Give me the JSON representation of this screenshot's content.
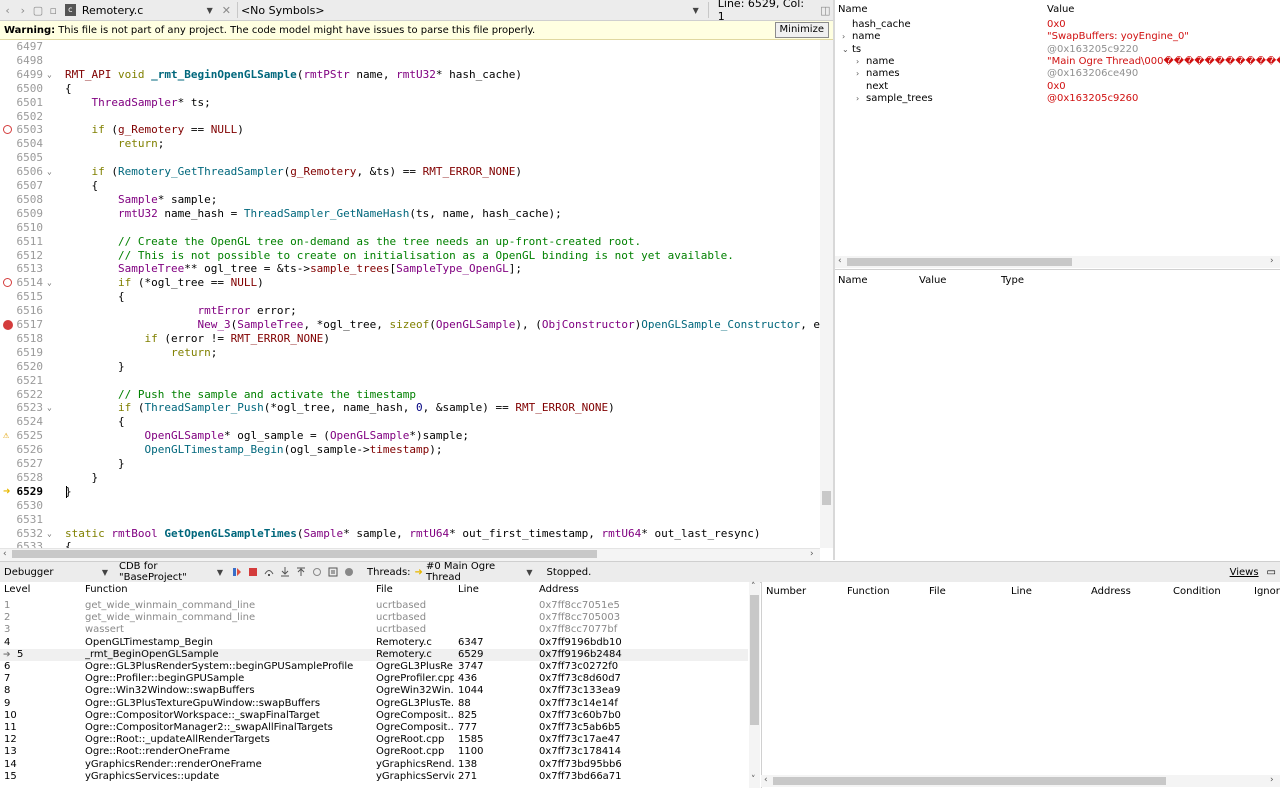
{
  "editor_toolbar": {
    "file_name": "Remotery.c",
    "file_icon": "c-file-icon",
    "symbols": "<No Symbols>",
    "line_col": "Line: 6529, Col: 1"
  },
  "warning": {
    "label": "Warning:",
    "message": "This file is not part of any project. The code model might have issues to parse this file properly.",
    "button": "Minimize"
  },
  "code_lines": [
    {
      "ln": "6497",
      "html": ""
    },
    {
      "ln": "6498",
      "html": ""
    },
    {
      "ln": "6499",
      "fold": true,
      "html": "<span class='mac'>RMT_API</span> <span class='kw'>void</span> <span class='bold-fn'>_rmt_BeginOpenGLSample</span>(<span class='tp'>rmtPStr</span> name, <span class='tp'>rmtU32</span>* hash_cache)"
    },
    {
      "ln": "6500",
      "html": "{"
    },
    {
      "ln": "6501",
      "html": "    <span class='tp'>ThreadSampler</span>* ts;"
    },
    {
      "ln": "6502",
      "html": ""
    },
    {
      "ln": "6503",
      "marker": "bp",
      "html": "    <span class='kw'>if</span> (<span class='mac'>g_Remotery</span> == <span class='mac'>NULL</span>)"
    },
    {
      "ln": "6504",
      "html": "        <span class='kw'>return</span>;"
    },
    {
      "ln": "6505",
      "html": ""
    },
    {
      "ln": "6506",
      "fold": true,
      "html": "    <span class='kw'>if</span> (<span class='fn'>Remotery_GetThreadSampler</span>(<span class='mac'>g_Remotery</span>, &amp;ts) == <span class='mac'>RMT_ERROR_NONE</span>)"
    },
    {
      "ln": "6507",
      "html": "    {"
    },
    {
      "ln": "6508",
      "html": "        <span class='tp'>Sample</span>* sample;"
    },
    {
      "ln": "6509",
      "html": "        <span class='tp'>rmtU32</span> name_hash = <span class='fn'>ThreadSampler_GetNameHash</span>(ts, name, hash_cache);"
    },
    {
      "ln": "6510",
      "html": ""
    },
    {
      "ln": "6511",
      "html": "        <span class='cm'>// Create the OpenGL tree on-demand as the tree needs an up-front-created root.</span>"
    },
    {
      "ln": "6512",
      "html": "        <span class='cm'>// This is not possible to create on initialisation as a OpenGL binding is not yet available.</span>"
    },
    {
      "ln": "6513",
      "html": "        <span class='tp'>SampleTree</span>** ogl_tree = &amp;ts-&gt;<span class='mac'>sample_trees</span>[<span class='tp'>SampleType_OpenGL</span>];"
    },
    {
      "ln": "6514",
      "marker": "bp",
      "fold": true,
      "html": "        <span class='kw'>if</span> (*ogl_tree == <span class='mac'>NULL</span>)"
    },
    {
      "ln": "6515",
      "html": "        {"
    },
    {
      "ln": "6516",
      "html": "                    <span class='tp'>rmtError</span> error;"
    },
    {
      "ln": "6517",
      "marker": "bpf",
      "html": "                    <span class='tp'>New_3</span>(<span class='tp'>SampleTree</span>, *ogl_tree, <span class='kw'>sizeof</span>(<span class='tp'>OpenGLSample</span>), (<span class='tp'>ObjConstructor</span>)<span class='fn'>OpenGLSample_Constructor</span>, error);"
    },
    {
      "ln": "6518",
      "html": "            <span class='kw'>if</span> (error != <span class='mac'>RMT_ERROR_NONE</span>)"
    },
    {
      "ln": "6519",
      "html": "                <span class='kw'>return</span>;"
    },
    {
      "ln": "6520",
      "html": "        }"
    },
    {
      "ln": "6521",
      "html": ""
    },
    {
      "ln": "6522",
      "html": "        <span class='cm'>// Push the sample and activate the timestamp</span>"
    },
    {
      "ln": "6523",
      "fold": true,
      "html": "        <span class='kw'>if</span> (<span class='fn'>ThreadSampler_Push</span>(*ogl_tree, name_hash, <span class='num'>0</span>, &amp;sample) == <span class='mac'>RMT_ERROR_NONE</span>)"
    },
    {
      "ln": "6524",
      "html": "        {"
    },
    {
      "ln": "6525",
      "marker": "warn",
      "html": "            <span class='tp'>OpenGLSample</span>* ogl_sample = (<span class='tp'>OpenGLSample</span>*)sample;"
    },
    {
      "ln": "6526",
      "html": "            <span class='fn'>OpenGLTimestamp_Begin</span>(ogl_sample-&gt;<span class='mac'>timestamp</span>);"
    },
    {
      "ln": "6527",
      "html": "        }"
    },
    {
      "ln": "6528",
      "html": "    }"
    },
    {
      "ln": "6529",
      "marker": "arrow",
      "current": true,
      "html": "}"
    },
    {
      "ln": "6530",
      "html": ""
    },
    {
      "ln": "6531",
      "html": ""
    },
    {
      "ln": "6532",
      "fold": true,
      "html": "<span class='kw'>static</span> <span class='tp'>rmtBool</span> <span class='bold-fn'>GetOpenGLSampleTimes</span>(<span class='tp'>Sample</span>* sample, <span class='tp'>rmtU64</span>* out_first_timestamp, <span class='tp'>rmtU64</span>* out_last_resync)"
    },
    {
      "ln": "6533",
      "html": "{"
    }
  ],
  "locals": {
    "headers": {
      "name": "Name",
      "value": "Value"
    },
    "rows": [
      {
        "indent": 0,
        "expand": "",
        "name": "hash_cache",
        "value": "0x0",
        "color": "red"
      },
      {
        "indent": 0,
        "expand": "›",
        "name": "name",
        "value": "\"SwapBuffers: yoyEngine_0\"",
        "color": "red"
      },
      {
        "indent": 0,
        "expand": "⌄",
        "name": "ts",
        "value": "@0x163205c9220",
        "color": "grey"
      },
      {
        "indent": 1,
        "expand": "›",
        "name": "name",
        "value": "\"Main Ogre Thread\\000����������������",
        "color": "red"
      },
      {
        "indent": 1,
        "expand": "›",
        "name": "names",
        "value": "@0x163206ce490",
        "color": "grey"
      },
      {
        "indent": 1,
        "expand": "",
        "name": "next",
        "value": "0x0",
        "color": "red"
      },
      {
        "indent": 1,
        "expand": "›",
        "name": "sample_trees",
        "value": "@0x163205c9260",
        "color": "red"
      }
    ]
  },
  "expressions": {
    "headers": {
      "name": "Name",
      "value": "Value",
      "type": "Type"
    }
  },
  "debugger_toolbar": {
    "mode": "Debugger",
    "engine": "CDB for \"BaseProject\"",
    "threads_label": "Threads:",
    "thread": "#0 Main Ogre Thread",
    "status": "Stopped.",
    "views": "Views"
  },
  "stack": {
    "headers": {
      "level": "Level",
      "function": "Function",
      "file": "File",
      "line": "Line",
      "address": "Address"
    },
    "rows": [
      {
        "level": "1",
        "function": "get_wide_winmain_command_line",
        "file": "ucrtbased",
        "line": "",
        "address": "0x7ff8cc7051e5",
        "dim": true
      },
      {
        "level": "2",
        "function": "get_wide_winmain_command_line",
        "file": "ucrtbased",
        "line": "",
        "address": "0x7ff8cc705003",
        "dim": true
      },
      {
        "level": "3",
        "function": "wassert",
        "file": "ucrtbased",
        "line": "",
        "address": "0x7ff8cc7077bf",
        "dim": true
      },
      {
        "level": "4",
        "function": "OpenGLTimestamp_Begin",
        "file": "Remotery.c",
        "line": "6347",
        "address": "0x7ff9196bdb10"
      },
      {
        "level": "5",
        "function": "_rmt_BeginOpenGLSample",
        "file": "Remotery.c",
        "line": "6529",
        "address": "0x7ff9196b2484",
        "current": true
      },
      {
        "level": "6",
        "function": "Ogre::GL3PlusRenderSystem::beginGPUSampleProfile",
        "file": "OgreGL3PlusRe...",
        "line": "3747",
        "address": "0x7ff73c0272f0"
      },
      {
        "level": "7",
        "function": "Ogre::Profiler::beginGPUSample",
        "file": "OgreProfiler.cpp",
        "line": "436",
        "address": "0x7ff73c8d60d7"
      },
      {
        "level": "8",
        "function": "Ogre::Win32Window::swapBuffers",
        "file": "OgreWin32Win...",
        "line": "1044",
        "address": "0x7ff73c133ea9"
      },
      {
        "level": "9",
        "function": "Ogre::GL3PlusTextureGpuWindow::swapBuffers",
        "file": "OgreGL3PlusTe...",
        "line": "88",
        "address": "0x7ff73c14e14f"
      },
      {
        "level": "10",
        "function": "Ogre::CompositorWorkspace::_swapFinalTarget",
        "file": "OgreComposit...",
        "line": "825",
        "address": "0x7ff73c60b7b0"
      },
      {
        "level": "11",
        "function": "Ogre::CompositorManager2::_swapAllFinalTargets",
        "file": "OgreComposit...",
        "line": "777",
        "address": "0x7ff73c5ab6b5"
      },
      {
        "level": "12",
        "function": "Ogre::Root::_updateAllRenderTargets",
        "file": "OgreRoot.cpp",
        "line": "1585",
        "address": "0x7ff73c17ae47"
      },
      {
        "level": "13",
        "function": "Ogre::Root::renderOneFrame",
        "file": "OgreRoot.cpp",
        "line": "1100",
        "address": "0x7ff73c178414"
      },
      {
        "level": "14",
        "function": "yGraphicsRender::renderOneFrame",
        "file": "yGraphicsRend...",
        "line": "138",
        "address": "0x7ff73bd95bb6"
      },
      {
        "level": "15",
        "function": "yGraphicsServices::update",
        "file": "yGraphicsServic...",
        "line": "271",
        "address": "0x7ff73bd66a71"
      }
    ]
  },
  "breakpoints": {
    "headers": {
      "number": "Number",
      "function": "Function",
      "file": "File",
      "line": "Line",
      "address": "Address",
      "condition": "Condition",
      "ignore": "Ignore"
    }
  }
}
